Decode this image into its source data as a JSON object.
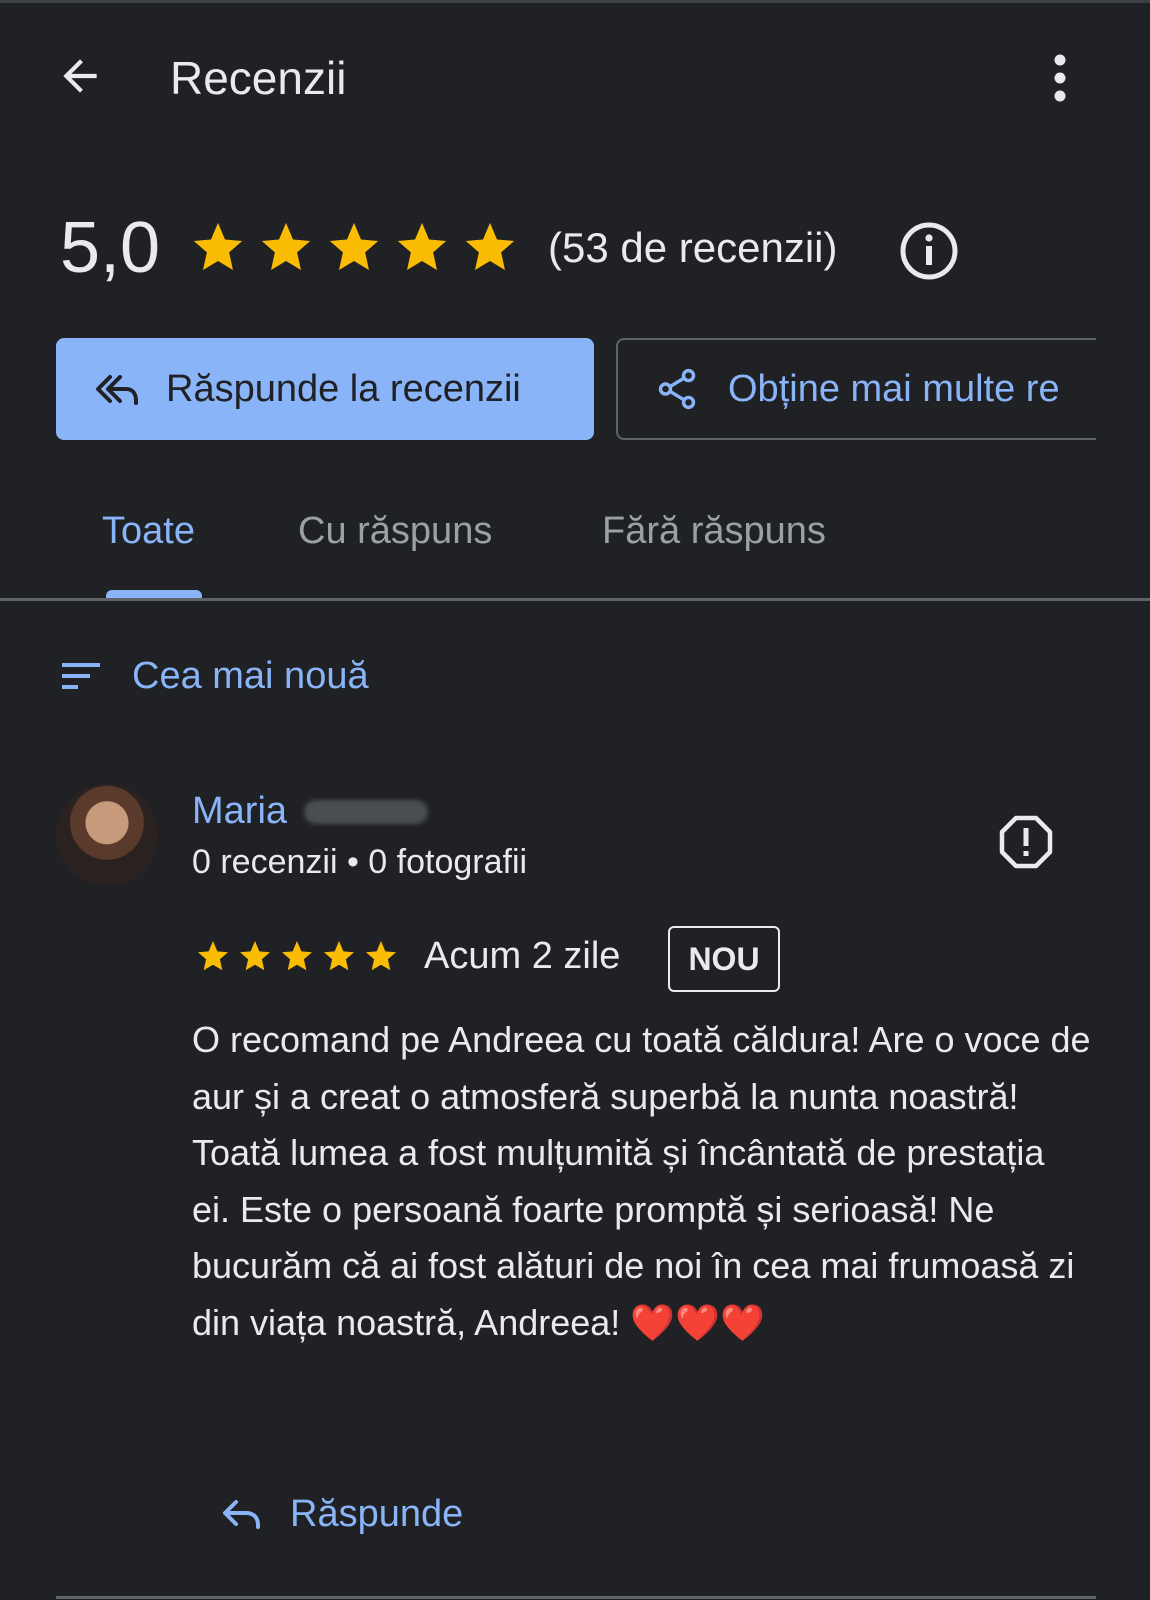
{
  "app": {
    "title": "Recenzii",
    "back_icon": "arrow-back-icon",
    "menu_icon": "more-vert-icon"
  },
  "summary": {
    "rating": "5,0",
    "stars": 5,
    "review_count": "(53 de recenzii)",
    "info_icon": "info-icon"
  },
  "actions": {
    "reply_reviews": "Răspunde la recenzii",
    "get_more": "Obține mai multe re"
  },
  "tabs": [
    {
      "label": "Toate",
      "selected": true
    },
    {
      "label": "Cu răspuns",
      "selected": false
    },
    {
      "label": "Fără răspuns",
      "selected": false
    }
  ],
  "sort": {
    "label": "Cea mai nouă",
    "icon": "sort-icon"
  },
  "review": {
    "author": "Maria",
    "stats": "0 recenzii • 0 fotografii",
    "stars": 5,
    "date": "Acum 2 zile",
    "badge": "NOU",
    "text": "O recomand pe Andreea cu toată căldura! Are o voce de aur și a creat o atmosferă superbă la nunta noastră! Toată lumea a fost mulțumită și încântată de prestația ei. Este o persoană foarte promptă și serioasă! Ne bucurăm că ai fost alături de noi în cea mai frumoasă zi din viața noastră, Andreea! ❤️❤️❤️",
    "reply_label": "Răspunde",
    "report_icon": "report-icon"
  },
  "colors": {
    "background": "#202124",
    "accent": "#8ab4f8",
    "star": "#fbbc04",
    "text": "#e8eaed",
    "muted": "#9aa0a6"
  }
}
